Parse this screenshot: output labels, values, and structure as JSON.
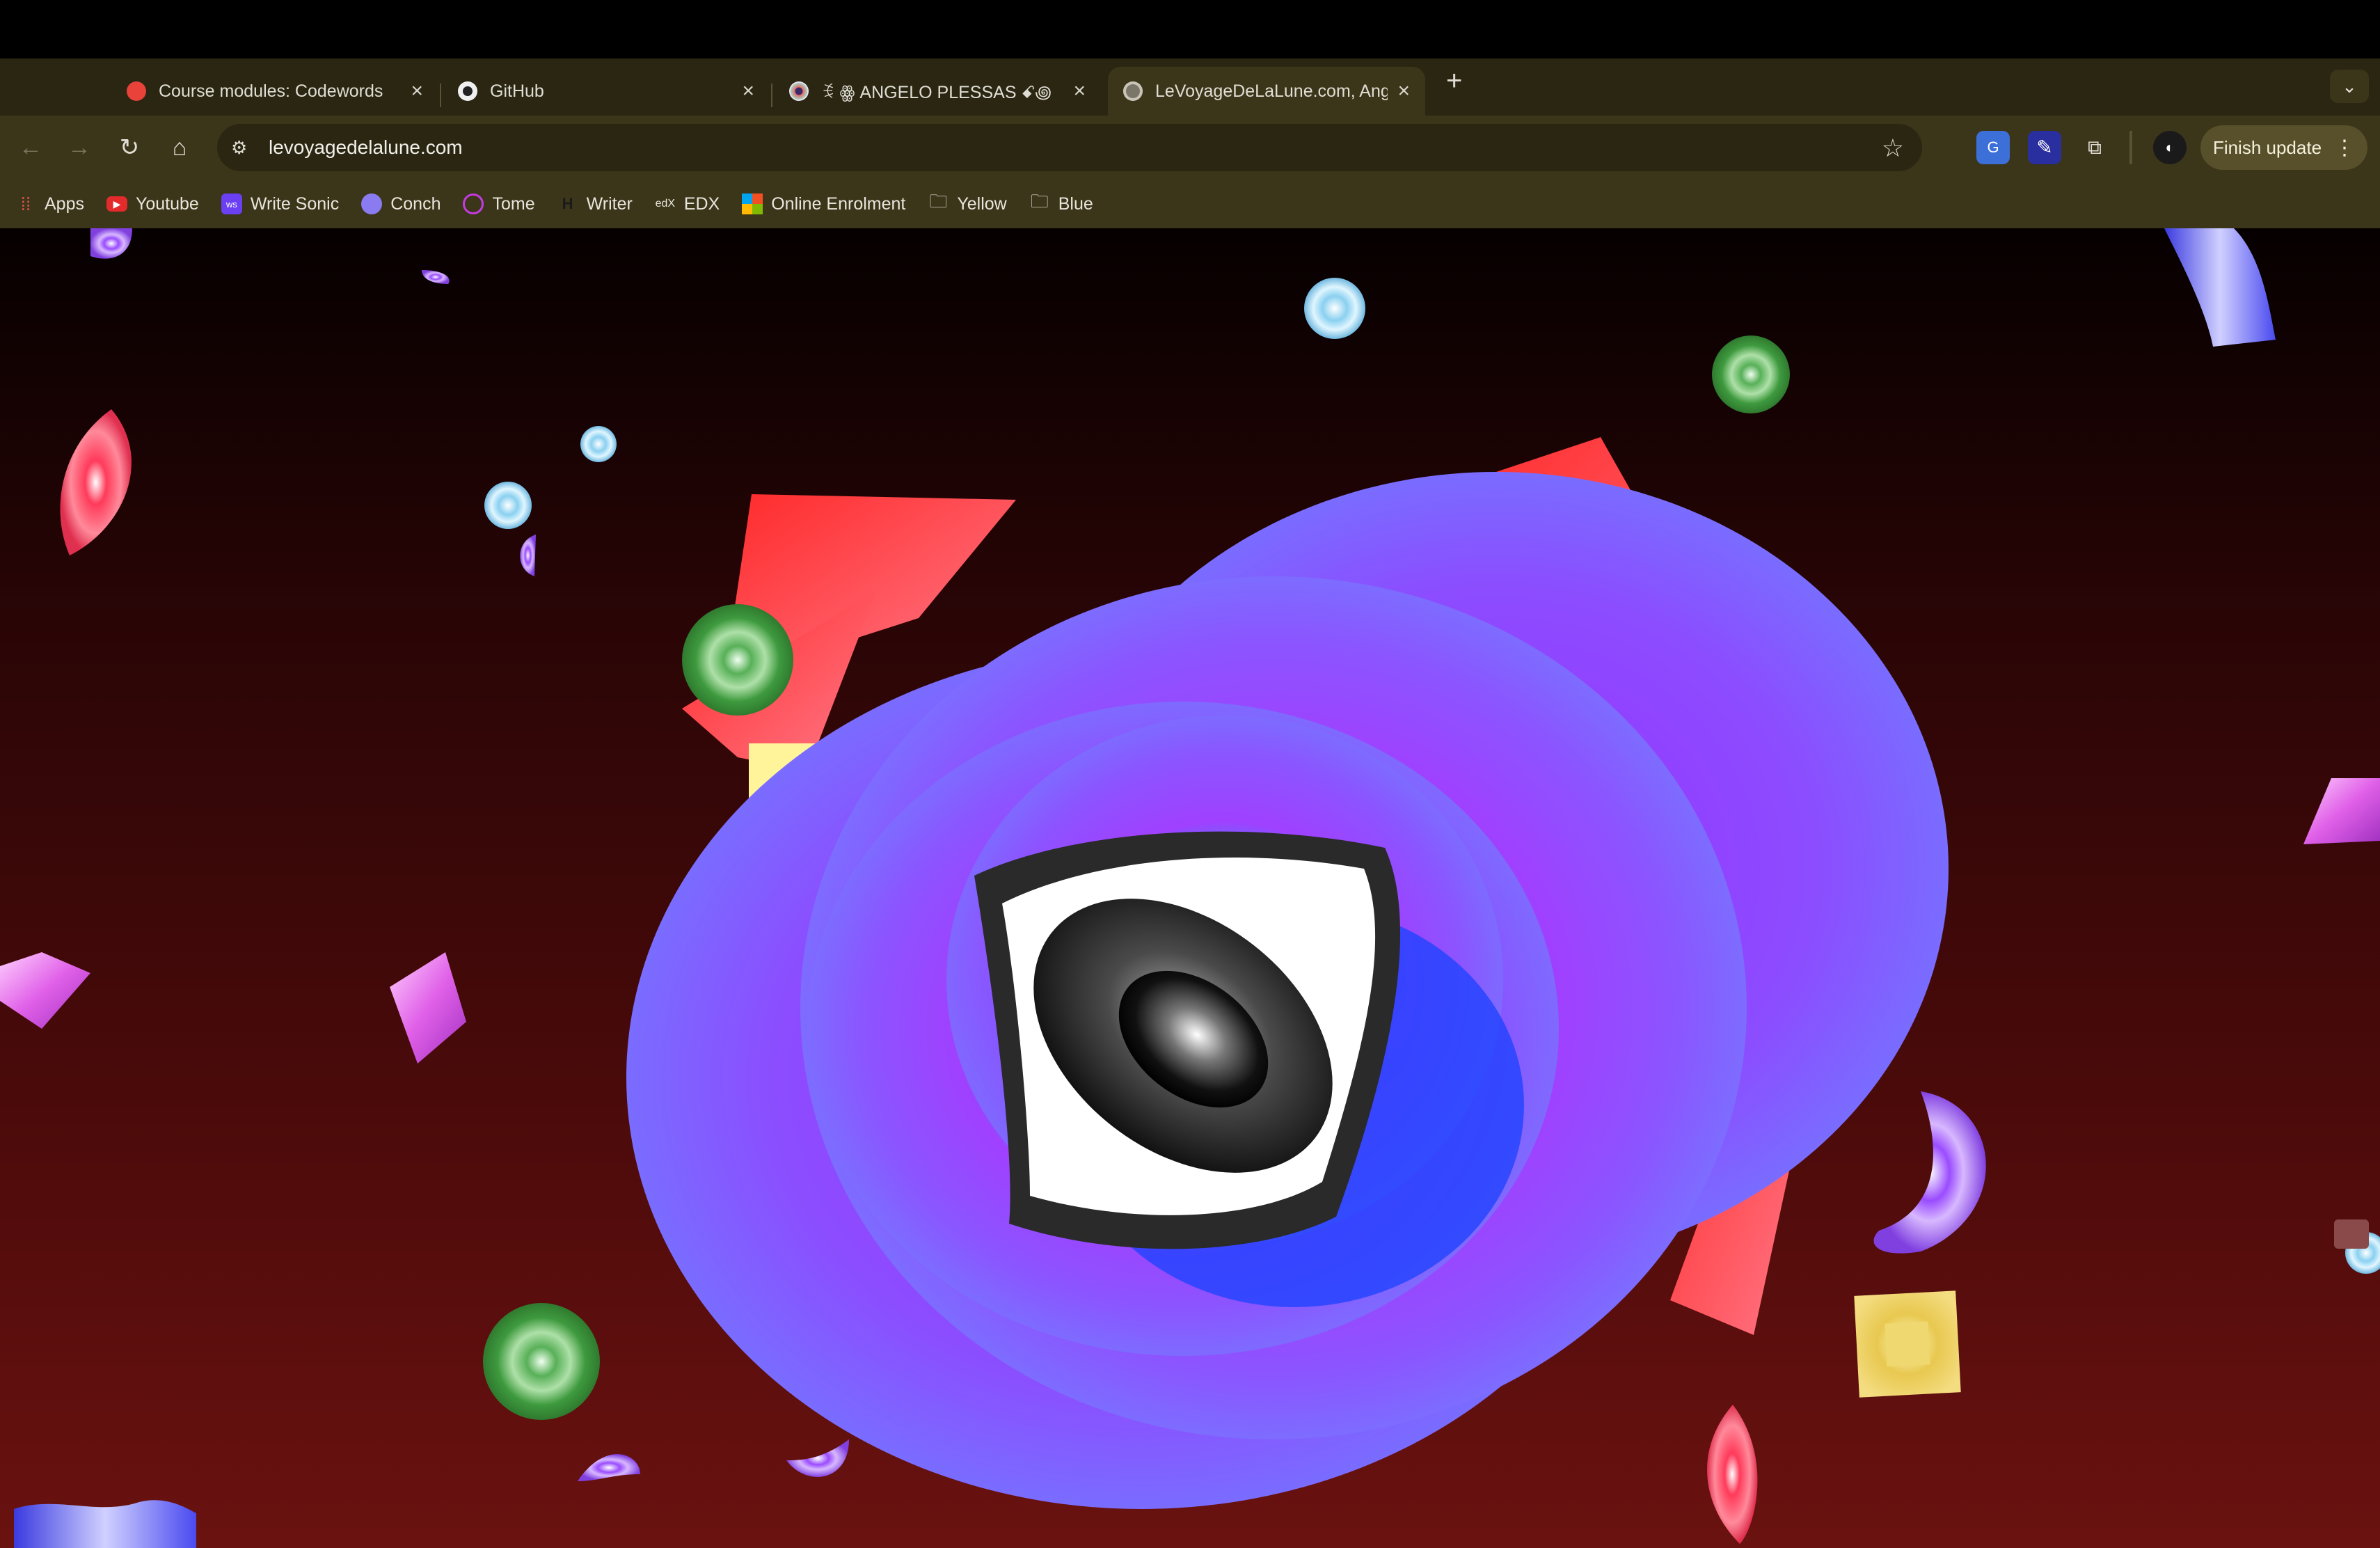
{
  "tabs": [
    {
      "title": "Course modules: Codewords",
      "favicon": "red-gear-icon",
      "active": false
    },
    {
      "title": "GitHub",
      "favicon": "github-icon",
      "active": false
    },
    {
      "title": "ꉂ ꙮ ANGELO PLESSAS ꗃ꩜",
      "favicon": "eye-favicon-icon",
      "active": false
    },
    {
      "title": "LeVoyageDeLaLune.com, Ang",
      "favicon": "globe-icon",
      "active": true
    }
  ],
  "toolbar": {
    "url": "levoyagedelalune.com",
    "finish_update_label": "Finish update"
  },
  "bookmarks": [
    {
      "label": "Apps",
      "icon": "apps-grid-icon"
    },
    {
      "label": "Youtube",
      "icon": "youtube-icon"
    },
    {
      "label": "Write Sonic",
      "icon": "writesonic-icon"
    },
    {
      "label": "Conch",
      "icon": "conch-icon"
    },
    {
      "label": "Tome",
      "icon": "tome-icon"
    },
    {
      "label": "Writer",
      "icon": "writer-icon"
    },
    {
      "label": "EDX",
      "icon": "edx-icon"
    },
    {
      "label": "Online Enrolment",
      "icon": "microsoft-icon"
    },
    {
      "label": "Yellow",
      "icon": "folder-icon"
    },
    {
      "label": "Blue",
      "icon": "folder-icon"
    }
  ],
  "colors": {
    "tabbar": "#2a2612",
    "toolbar": "#3b3519",
    "page_top": "#060000",
    "page_bottom": "#6a1210",
    "accent_purple": "#8b3dff",
    "accent_red": "#ff3030"
  }
}
